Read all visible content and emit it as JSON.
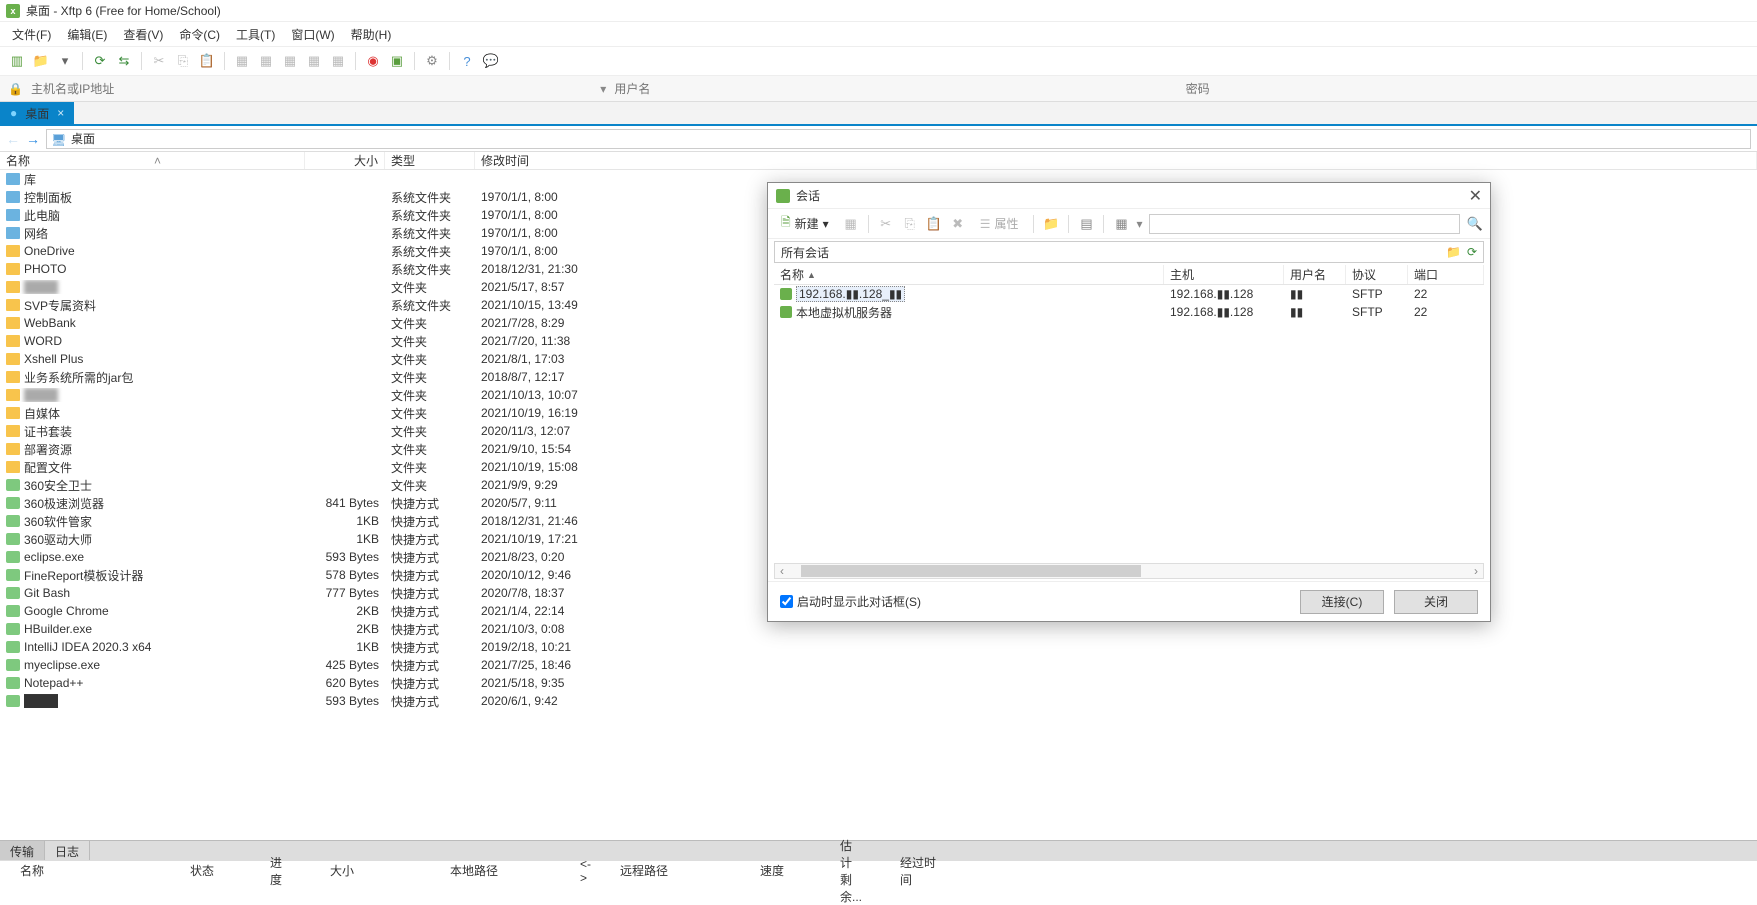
{
  "title": "桌面 - Xftp 6 (Free for Home/School)",
  "menu": [
    "文件(F)",
    "编辑(E)",
    "查看(V)",
    "命令(C)",
    "工具(T)",
    "窗口(W)",
    "帮助(H)"
  ],
  "addr": {
    "placeholder": "主机名或IP地址",
    "user_ph": "用户名",
    "pass_ph": "密码"
  },
  "tab": {
    "label": "桌面"
  },
  "path": {
    "label": "桌面"
  },
  "cols": {
    "name": "名称",
    "size": "大小",
    "type": "类型",
    "mod": "修改时间"
  },
  "files": [
    {
      "ico": "sys",
      "n": "库",
      "s": "",
      "t": "",
      "m": ""
    },
    {
      "ico": "sys",
      "n": "控制面板",
      "s": "",
      "t": "系统文件夹",
      "m": "1970/1/1, 8:00"
    },
    {
      "ico": "sys",
      "n": "此电脑",
      "s": "",
      "t": "系统文件夹",
      "m": "1970/1/1, 8:00"
    },
    {
      "ico": "sys",
      "n": "网络",
      "s": "",
      "t": "系统文件夹",
      "m": "1970/1/1, 8:00"
    },
    {
      "ico": "folder",
      "n": "OneDrive",
      "s": "",
      "t": "系统文件夹",
      "m": "1970/1/1, 8:00"
    },
    {
      "ico": "folder",
      "n": "PHOTO",
      "s": "",
      "t": "系统文件夹",
      "m": "2018/12/31, 21:30"
    },
    {
      "ico": "folder",
      "n": "",
      "s": "",
      "t": "文件夹",
      "m": "2021/5/17, 8:57",
      "blur": true
    },
    {
      "ico": "folder",
      "n": "SVP专属资料",
      "s": "",
      "t": "系统文件夹",
      "m": "2021/10/15, 13:49"
    },
    {
      "ico": "folder",
      "n": "WebBank",
      "s": "",
      "t": "文件夹",
      "m": "2021/7/28, 8:29"
    },
    {
      "ico": "folder",
      "n": "WORD",
      "s": "",
      "t": "文件夹",
      "m": "2021/7/20, 11:38"
    },
    {
      "ico": "folder",
      "n": "Xshell Plus",
      "s": "",
      "t": "文件夹",
      "m": "2021/8/1, 17:03"
    },
    {
      "ico": "folder",
      "n": "业务系统所需的jar包",
      "s": "",
      "t": "文件夹",
      "m": "2018/8/7, 12:17"
    },
    {
      "ico": "folder",
      "n": "",
      "s": "",
      "t": "文件夹",
      "m": "2021/10/13, 10:07",
      "blur": true
    },
    {
      "ico": "folder",
      "n": "自媒体",
      "s": "",
      "t": "文件夹",
      "m": "2021/10/19, 16:19"
    },
    {
      "ico": "folder",
      "n": "证书套装",
      "s": "",
      "t": "文件夹",
      "m": "2020/11/3, 12:07"
    },
    {
      "ico": "folder",
      "n": "部署资源",
      "s": "",
      "t": "文件夹",
      "m": "2021/9/10, 15:54"
    },
    {
      "ico": "folder",
      "n": "配置文件",
      "s": "",
      "t": "文件夹",
      "m": "2021/10/19, 15:08"
    },
    {
      "ico": "app",
      "n": "360安全卫士",
      "s": "",
      "t": "文件夹",
      "m": "2021/9/9, 9:29"
    },
    {
      "ico": "app",
      "n": "360极速浏览器",
      "s": "841 Bytes",
      "t": "快捷方式",
      "m": "2020/5/7, 9:11"
    },
    {
      "ico": "app",
      "n": "360软件管家",
      "s": "1KB",
      "t": "快捷方式",
      "m": "2018/12/31, 21:46"
    },
    {
      "ico": "app",
      "n": "360驱动大师",
      "s": "1KB",
      "t": "快捷方式",
      "m": "2021/10/19, 17:21"
    },
    {
      "ico": "app",
      "n": "eclipse.exe",
      "s": "593 Bytes",
      "t": "快捷方式",
      "m": "2021/8/23, 0:20"
    },
    {
      "ico": "app",
      "n": "FineReport模板设计器",
      "s": "578 Bytes",
      "t": "快捷方式",
      "m": "2020/10/12, 9:46"
    },
    {
      "ico": "app",
      "n": "Git Bash",
      "s": "777 Bytes",
      "t": "快捷方式",
      "m": "2020/7/8, 18:37"
    },
    {
      "ico": "app",
      "n": "Google Chrome",
      "s": "2KB",
      "t": "快捷方式",
      "m": "2021/1/4, 22:14"
    },
    {
      "ico": "app",
      "n": "HBuilder.exe",
      "s": "2KB",
      "t": "快捷方式",
      "m": "2021/10/3, 0:08"
    },
    {
      "ico": "app",
      "n": "IntelliJ IDEA 2020.3 x64",
      "s": "1KB",
      "t": "快捷方式",
      "m": "2019/2/18, 10:21"
    },
    {
      "ico": "app",
      "n": "myeclipse.exe",
      "s": "425 Bytes",
      "t": "快捷方式",
      "m": "2021/7/25, 18:46"
    },
    {
      "ico": "app",
      "n": "Notepad++",
      "s": "620 Bytes",
      "t": "快捷方式",
      "m": "2021/5/18, 9:35"
    },
    {
      "ico": "app",
      "n": "",
      "s": "593 Bytes",
      "t": "快捷方式",
      "m": "2020/6/1, 9:42"
    }
  ],
  "btabs": {
    "transfer": "传输",
    "log": "日志"
  },
  "scols": [
    "名称",
    "状态",
    "进度",
    "大小",
    "本地路径",
    "<->",
    "远程路径",
    "速度",
    "估计剩余...",
    "经过时间"
  ],
  "dialog": {
    "title": "会话",
    "new": "新建",
    "props": "属性",
    "crumb": "所有会话",
    "heads": {
      "name": "名称",
      "host": "主机",
      "user": "用户名",
      "proto": "协议",
      "port": "端口"
    },
    "rows": [
      {
        "n": "192.168.▮▮.128_▮▮",
        "h": "192.168.▮▮.128",
        "u": "▮▮",
        "p": "SFTP",
        "port": "22",
        "sel": true
      },
      {
        "n": "本地虚拟机服务器",
        "h": "192.168.▮▮.128",
        "u": "▮▮",
        "p": "SFTP",
        "port": "22"
      }
    ],
    "startup": "启动时显示此对话框(S)",
    "connect": "连接(C)",
    "close": "关闭"
  }
}
